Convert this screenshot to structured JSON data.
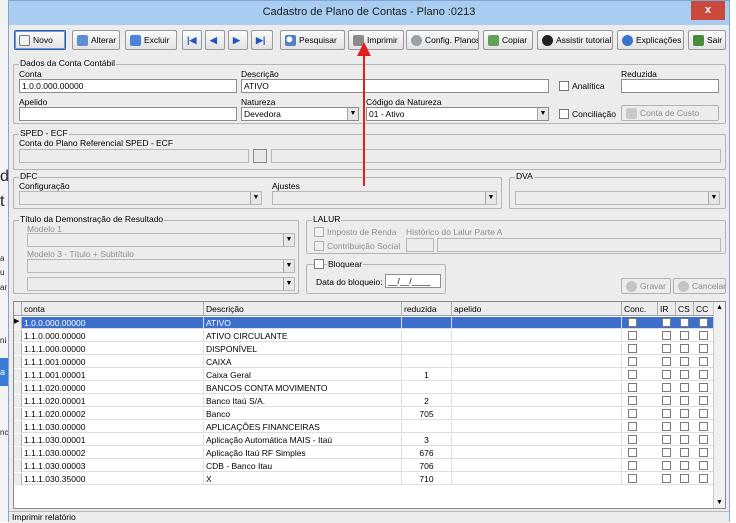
{
  "window": {
    "title": "Cadastro de Plano de Contas - Plano :0213",
    "close": "x"
  },
  "toolbar": [
    {
      "key": "novo",
      "label": "Novo",
      "icon": "new-document-icon"
    },
    {
      "key": "alterar",
      "label": "Alterar",
      "icon": "edit-icon"
    },
    {
      "key": "excluir",
      "label": "Excluir",
      "icon": "delete-icon"
    },
    {
      "key": "first",
      "label": "",
      "icon": "first-record-icon",
      "glyph": "|◀"
    },
    {
      "key": "prev",
      "label": "",
      "icon": "previous-record-icon",
      "glyph": "◀"
    },
    {
      "key": "next",
      "label": "",
      "icon": "next-record-icon",
      "glyph": "▶"
    },
    {
      "key": "last",
      "label": "",
      "icon": "last-record-icon",
      "glyph": "▶|"
    },
    {
      "key": "pesquisar",
      "label": "Pesquisar",
      "icon": "search-icon"
    },
    {
      "key": "imprimir",
      "label": "Imprimir",
      "icon": "print-icon"
    },
    {
      "key": "config",
      "label": "Config. Planos",
      "icon": "config-icon"
    },
    {
      "key": "copiar",
      "label": "Copiar",
      "icon": "copy-icon"
    },
    {
      "key": "tutorial",
      "label": "Assistir tutorial",
      "icon": "play-icon"
    },
    {
      "key": "explicacoes",
      "label": "Explicações",
      "icon": "info-icon"
    },
    {
      "key": "sair",
      "label": "Sair",
      "icon": "exit-icon"
    }
  ],
  "dados": {
    "legend": "Dados da Conta Contábil",
    "conta_label": "Conta",
    "conta": "1.0.0.000.00000",
    "descricao_label": "Descrição",
    "descricao": "ATIVO",
    "analitica_label": "Analítica",
    "reduzida_label": "Reduzida",
    "reduzida": "",
    "apelido_label": "Apelido",
    "apelido": "",
    "natureza_label": "Natureza",
    "natureza": "Devedora",
    "codigo_natureza_label": "Código da Natureza",
    "codigo_natureza": "01 - Ativo",
    "conciliacao_label": "Conciliação",
    "centro_custo_label": "Conta de Custo"
  },
  "sped": {
    "legend": "SPED - ECF",
    "ref_label": "Conta do Plano Referencial SPED - ECF"
  },
  "dfc": {
    "legend": "DFC",
    "configuracao_label": "Configuração",
    "ajustes_label": "Ajustes"
  },
  "dva": {
    "legend": "DVA"
  },
  "dre": {
    "legend": "Título da Demonstração de Resultado",
    "modelo1_label": "Modelo 1",
    "modelo3_label": "Modelo 3 - Título + Subtítulo"
  },
  "lalur": {
    "legend": "LALUR",
    "imposto_label": "Imposto de Renda",
    "historico_label": "Histórico do Lalur Parte A",
    "contribuicao_label": "Contribuição Social"
  },
  "bloqueio": {
    "bloquear_label": "Bloquear",
    "data_label": "Data do bloqueio:",
    "data_value": "__/__/____"
  },
  "actions": {
    "gravar": "Gravar",
    "cancelar": "Cancelar"
  },
  "grid": {
    "headers": [
      "conta",
      "Descrição",
      "reduzida",
      "apelido",
      "Conc.",
      "IR",
      "CS",
      "CC"
    ],
    "rows": [
      {
        "conta": "1.0.0.000.00000",
        "descricao": "ATIVO",
        "reduzida": "",
        "selected": true
      },
      {
        "conta": "1.1.0.000.00000",
        "descricao": "ATIVO CIRCULANTE",
        "reduzida": ""
      },
      {
        "conta": "1.1.1.000.00000",
        "descricao": "DISPONÍVEL",
        "reduzida": ""
      },
      {
        "conta": "1.1.1.001.00000",
        "descricao": "CAIXA",
        "reduzida": ""
      },
      {
        "conta": "1.1.1.001.00001",
        "descricao": "Caixa Geral",
        "reduzida": "1"
      },
      {
        "conta": "1.1.1.020.00000",
        "descricao": "BANCOS CONTA MOVIMENTO",
        "reduzida": ""
      },
      {
        "conta": "1.1.1.020.00001",
        "descricao": "Banco Itaú S/A.",
        "reduzida": "2"
      },
      {
        "conta": "1.1.1.020.00002",
        "descricao": "Banco",
        "reduzida": "705"
      },
      {
        "conta": "1.1.1.030.00000",
        "descricao": "APLICAÇÕES FINANCEIRAS",
        "reduzida": ""
      },
      {
        "conta": "1.1.1.030.00001",
        "descricao": "Aplicação Automática MAIS - Itaú",
        "reduzida": "3"
      },
      {
        "conta": "1.1.1.030.00002",
        "descricao": "Aplicação Itaú RF Simples",
        "reduzida": "676"
      },
      {
        "conta": "1.1.1.030.00003",
        "descricao": "CDB - Banco Itau",
        "reduzida": "706"
      },
      {
        "conta": "1.1.1.030.35000",
        "descricao": "X",
        "reduzida": "710"
      }
    ]
  },
  "status": {
    "text": "Imprimir relatório"
  },
  "background": {
    "frag1": "d",
    "frag2": "t",
    "frag3": "a",
    "frag4": "u",
    "frag5": "ar",
    "frag6": "ni",
    "frag7": "a",
    "frag8": "nc"
  },
  "colors": {
    "titlebar": "#a9cdf0",
    "selection": "#3b6fcb",
    "close": "#c94a3d",
    "arrow": "#e0201e"
  }
}
